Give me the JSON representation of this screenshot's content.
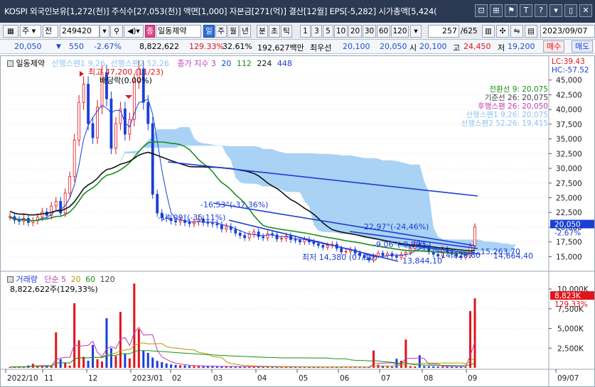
{
  "window": {
    "title": "KOSPI 외국인보유[1,272(천)] 주식수[27,053(천)] 액면[1,000] 자본금[271(억)] 결산[12월] EPS[-5,282] 시가총액[5,424(",
    "buttons": [
      "⊡",
      "⊞",
      "⚑",
      "T",
      "?",
      "▾",
      "▯",
      "✕"
    ]
  },
  "toolbar": {
    "period_label": "주",
    "market_label": "전",
    "code_value": "249420",
    "stock_label": "일동제약",
    "pink_label": "종",
    "intervals": [
      "일",
      "주",
      "월",
      "년",
      "분",
      "초",
      "틱"
    ],
    "minutes": [
      "1",
      "3",
      "5",
      "10",
      "20",
      "30",
      "60",
      "120"
    ],
    "page_value": "257",
    "page_total": "/625",
    "date_value": "2023/09/07"
  },
  "quote": {
    "price": "20,050",
    "change": "550",
    "change_pct": "-2.67%",
    "volume": "8,822,622",
    "volume_ratio": "129.33%",
    "turnover": "32.61%",
    "amount": "192,627백만",
    "bid_label": "최우선",
    "bid": "20,100",
    "ask": "20,050",
    "open_label": "시",
    "open": "20,100",
    "high_label": "고",
    "high": "24,450",
    "low_label": "저",
    "low": "19,200",
    "buy_label": "매수",
    "sell_label": "매도"
  },
  "legend": {
    "stock": "일동제약",
    "span1": "선행스팬1 9,26",
    "span2": "선행스팬2 52,26",
    "ma_label": "종가 지수 3",
    "ma_periods": [
      "20",
      "112",
      "224",
      "448"
    ],
    "lc": "LC:39.43",
    "hc": "HC:-57.52"
  },
  "ichimoku_labels": {
    "conversion": "전환선 9: 20,075",
    "base": "기준선 26: 20,075",
    "lagging": "후행스팬 26: 20,050",
    "span1": "선행스팬1 9,26: 20,075",
    "span2": "선행스팬2 52,26: 19,415"
  },
  "annotations": {
    "high": "최고 47,200 (11/23)",
    "dividend": "배당락(0.00%)",
    "low": "최저 14,380 (07/10)",
    "t1": "-16,53°(-37,36%)",
    "t2": "-14,09°(-35,11%)",
    "t3": "-22,97°(-24,46%)",
    "t4": "-9,06°(-9,88%)",
    "p1": "13,844,10",
    "p2": "14,826,60",
    "p3": "15,263,70",
    "p4": "14,664,40"
  },
  "volume_legend": {
    "label": "거래량",
    "ma_label": "단순 5",
    "periods": [
      "20",
      "60",
      "120"
    ],
    "value": "8,822,622주(129,33%)",
    "last_value": "8,823K",
    "last_pct": "129.33%"
  },
  "colors": {
    "up": "#e0141a",
    "down": "#1a3fd6",
    "cloud": "#8ec3f0",
    "ma20": "#1a3fd6",
    "ma112": "#1a8f1a",
    "ma224": "#111111",
    "trend": "#1a3fd6"
  },
  "chart_data": {
    "type": "line",
    "price_axis": {
      "ticks": [
        45000,
        42500,
        40000,
        37500,
        35000,
        32500,
        30000,
        27500,
        25000,
        22500,
        20000,
        17500,
        15000
      ],
      "tick_labels": [
        "45,000",
        "42,500",
        "40,000",
        "37,500",
        "35,000",
        "32,500",
        "30,000",
        "27,500",
        "25,000",
        "22,500",
        "20,000",
        "17,500",
        "15,000"
      ],
      "ylim": [
        13000,
        47500
      ],
      "last_price": "20,050",
      "last_pct": "-2.67%"
    },
    "volume_axis": {
      "ticks": [
        10000,
        7500,
        5000,
        2500
      ],
      "tick_labels": [
        "10,000K",
        "7,500K",
        "5,000K",
        "2,500K"
      ],
      "ylim": [
        0,
        11000
      ]
    },
    "x_labels": [
      "2022/10",
      "11",
      "12",
      "2023/01",
      "02",
      "03",
      "04",
      "05",
      "06",
      "07",
      "08",
      "09",
      "09/07"
    ],
    "close_series": [
      21800,
      21200,
      21000,
      21500,
      20800,
      21100,
      21700,
      22600,
      22000,
      23600,
      24400,
      22400,
      25800,
      28600,
      34800,
      41200,
      44300,
      37600,
      35200,
      40400,
      46200,
      41800,
      33400,
      37600,
      40100,
      35800,
      38300,
      44800,
      46900,
      41200,
      37600,
      25600,
      22400,
      21600,
      21500,
      21100,
      20900,
      21200,
      20800,
      20600,
      20900,
      21400,
      20800,
      20700,
      20600,
      20400,
      19700,
      20100,
      19600,
      19000,
      18600,
      18200,
      18800,
      19200,
      18400,
      18200,
      18900,
      18700,
      18000,
      18100,
      18500,
      17900,
      17800,
      17500,
      17900,
      17500,
      17200,
      16900,
      16600,
      16900,
      17100,
      16400,
      15800,
      15900,
      16200,
      15600,
      15200,
      14800,
      14400,
      15100,
      15600,
      15200,
      15500,
      15100,
      14900,
      15400,
      15700,
      16400,
      17200,
      16900,
      16500,
      15800,
      15400,
      15100,
      16300,
      15800,
      15400,
      15100,
      14900,
      15200,
      16800,
      20050
    ],
    "volume_series": [
      100,
      120,
      150,
      110,
      300,
      520,
      240,
      180,
      200,
      160,
      4500,
      1100,
      650,
      280,
      8200,
      3500,
      1400,
      900,
      2900,
      1100,
      800,
      6300,
      2500,
      1500,
      7100,
      1800,
      1200,
      10700,
      4900,
      2200,
      1900,
      1300,
      880,
      720,
      560,
      430,
      380,
      330,
      310,
      260,
      240,
      220,
      210,
      200,
      190,
      180,
      175,
      170,
      165,
      160,
      155,
      150,
      145,
      140,
      150,
      130,
      120,
      125,
      118,
      115,
      110,
      112,
      108,
      105,
      100,
      102,
      98,
      95,
      92,
      110,
      130,
      115,
      120,
      105,
      110,
      95,
      90,
      88,
      92,
      2200,
      400,
      250,
      180,
      160,
      1150,
      900,
      3600,
      220,
      180,
      1600,
      240,
      210,
      200,
      180,
      170,
      160,
      150,
      140,
      130,
      120,
      7200,
      8823
    ]
  }
}
